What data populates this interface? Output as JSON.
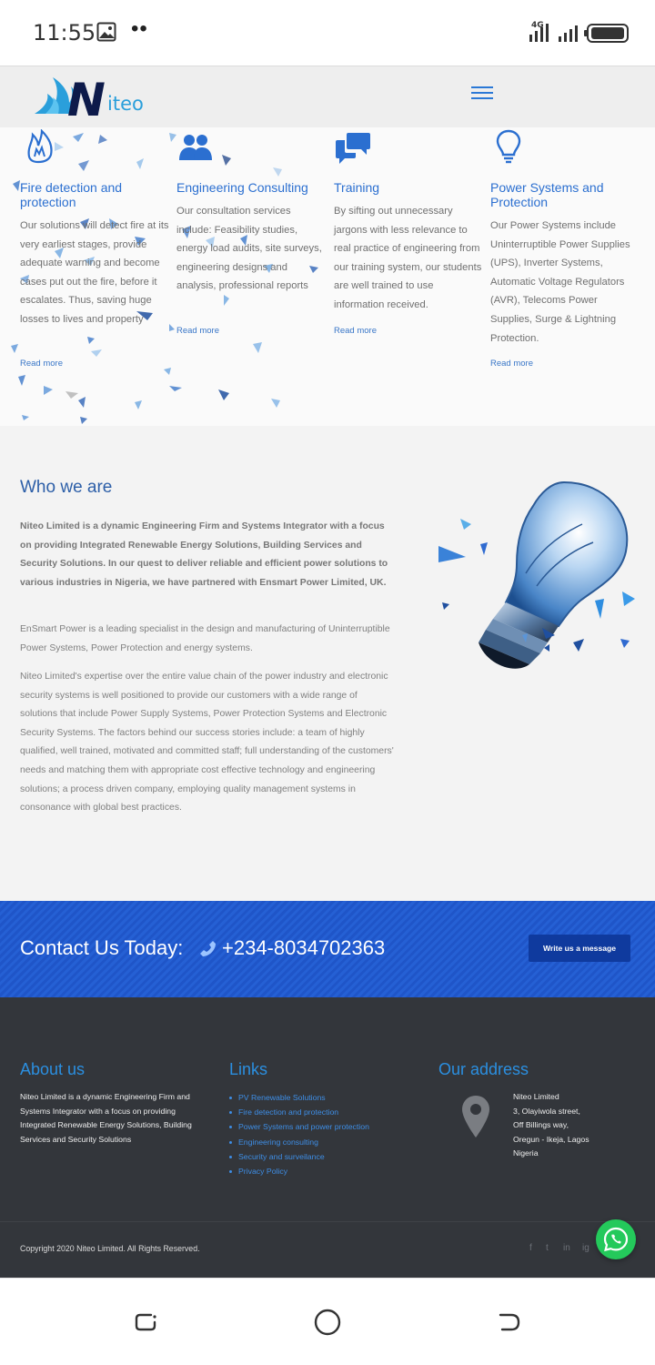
{
  "status_bar": {
    "time": "11:55",
    "dots": "••",
    "network": "4G"
  },
  "header": {
    "logo_text": "iteo",
    "logo_letter": "N",
    "menu_icon": "hamburger-menu-icon"
  },
  "services": [
    {
      "icon": "fire-icon",
      "title": "Fire detection and protection",
      "text": "Our solutions will detect fire at its very earliest stages, provide adequate warning and become cases put out the fire, before it escalates. Thus, saving huge losses to lives and property",
      "more": "Read more"
    },
    {
      "icon": "users-icon",
      "title": "Engineering Consulting",
      "text": "Our consultation services include: Feasibility studies, energy load audits, site surveys, engineering designs and analysis, professional reports",
      "more": "Read more"
    },
    {
      "icon": "chat-bubbles-icon",
      "title": "Training",
      "text": "By sifting out unnecessary jargons with less relevance to real practice of engineering from our training system, our students are well trained to use information received.",
      "more": "Read more"
    },
    {
      "icon": "lightbulb-icon",
      "title": "Power Systems and Protection",
      "text": "Our Power Systems include Uninterruptible Power Supplies (UPS), Inverter Systems, Automatic Voltage Regulators (AVR), Telecoms Power Supplies, Surge & Lightning Protection.",
      "more": "Read more"
    }
  ],
  "who": {
    "title": "Who we are",
    "bold_paragraph": "Niteo Limited is a dynamic Engineering Firm and Systems Integrator with a focus on providing Integrated Renewable Energy Solutions, Building Services and Security Solutions. In our quest to deliver reliable and efficient power solutions to various industries in Nigeria, we have partnered with Ensmart Power Limited, UK.",
    "paragraph_2": "EnSmart Power is a leading specialist in the design and manufacturing of Uninterruptible Power Systems, Power Protection and energy systems.",
    "paragraph_3": "Niteo Limited's expertise over the entire value chain of the power industry and electronic security systems is well positioned to provide our customers with a wide range of solutions that include Power Supply Systems, Power Protection Systems and Electronic Security Systems. The factors behind our success stories include: a team of highly qualified, well trained, motivated and committed staff; full understanding of the customers' needs and matching them with appropriate cost effective technology and engineering solutions; a process driven company, employing quality management systems in consonance with global best practices."
  },
  "contact": {
    "label": "Contact Us Today:",
    "phone": "+234-8034702363",
    "button": "Write us a message"
  },
  "footer": {
    "about_title": "About us",
    "about_text": "Niteo Limited is a dynamic Engineering Firm and Systems Integrator with a focus on providing Integrated Renewable Energy Solutions, Building Services and Security Solutions",
    "links_title": "Links",
    "links": [
      "PV Renewable Solutions",
      "Fire detection and protection",
      "Power Systems and power protection",
      "Engineering consulting",
      "Security and surveilance",
      "Privacy Policy"
    ],
    "address_title": "Our address",
    "address_lines": [
      "Niteo Limited",
      "3, Olayiwola street,",
      "Off Billings way,",
      "Oregun - Ikeja, Lagos",
      "Nigeria"
    ],
    "copyright": "Copyright 2020 Niteo Limited. All Rights Reserved.",
    "social": [
      "f",
      "t",
      "in",
      "ig"
    ]
  },
  "colors": {
    "brand_blue": "#2b6fd0",
    "contact_band": "#1f55c8",
    "footer_bg": "#33363b",
    "whatsapp_green": "#24c95b"
  }
}
